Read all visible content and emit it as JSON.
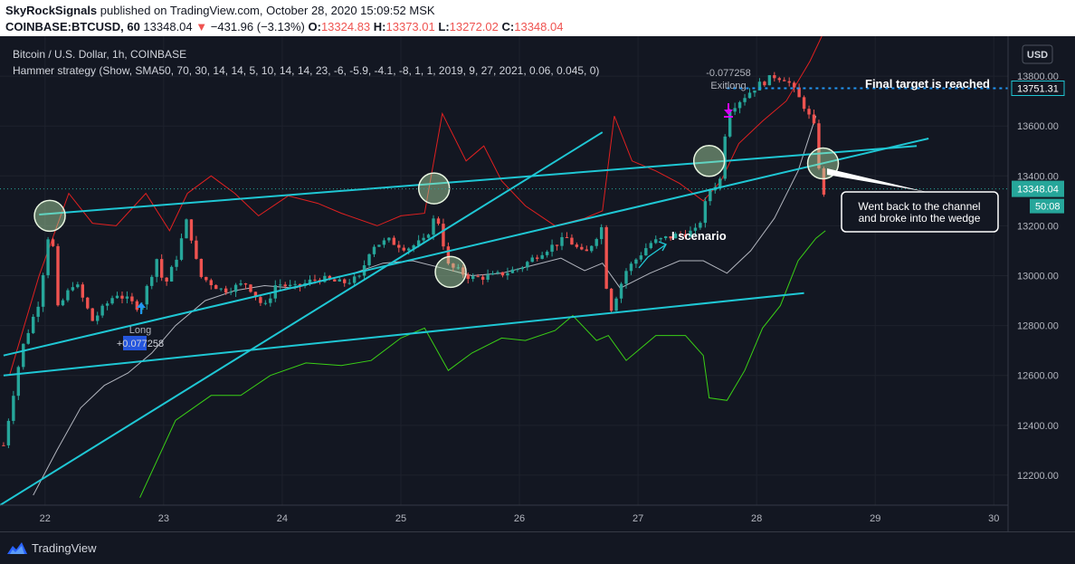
{
  "header": {
    "author": "SkyRockSignals",
    "published_text": "published on TradingView.com, October 28, 2020 15:09:52 MSK",
    "symbol": "COINBASE:BTCUSD, 60",
    "last": "13348.04",
    "change_arrow": "▼",
    "change": "−431.96 (−3.13%)",
    "o_label": "O:",
    "o": "13324.83",
    "h_label": "H:",
    "h": "13373.01",
    "l_label": "L:",
    "l": "13272.02",
    "c_label": "C:",
    "c": "13348.04"
  },
  "legend": {
    "title": "Bitcoin / U.S. Dollar, 1h, COINBASE",
    "study": "Hammer strategy (Show, SMA50, 70, 30, 14, 14, 5, 10, 14, 14, 23, -6, -5.9, -4.1, -8, 1, 1, 2019, 9, 27, 2021, 0.06, 0.045, 0)"
  },
  "currency_button": "USD",
  "price_tags": {
    "target": "13751.31",
    "last": "13348.04",
    "countdown": "50:08"
  },
  "annotations": {
    "final_target": "Final target is reached",
    "scenario": "I scenario",
    "callout_line1": "Went back to the channel",
    "callout_line2": "and broke into the wedge",
    "long_label": "Long",
    "long_value": "+0.077258",
    "exit_value": "-0.077258",
    "exit_label": "Exitlong"
  },
  "footer": {
    "brand": "TradingView"
  },
  "colors": {
    "background": "#131722",
    "up": "#26a69a",
    "down": "#ef5350",
    "trendline": "#1fc7d4",
    "upper_band": "#e02020",
    "lower_band": "#3ad016",
    "sma": "#b2b5be",
    "target_line": "#2196f3"
  },
  "chart_data": {
    "type": "candlestick",
    "title": "Bitcoin / U.S. Dollar, 1h, COINBASE",
    "x_ticks": [
      "22",
      "23",
      "24",
      "25",
      "26",
      "27",
      "28",
      "29",
      "30"
    ],
    "y_ticks": [
      "12200.00",
      "12400.00",
      "12600.00",
      "12800.00",
      "13000.00",
      "13200.00",
      "13400.00",
      "13600.00",
      "13800.00"
    ],
    "ylim": [
      12080,
      13960
    ],
    "xlim_days": [
      21.62,
      30.12
    ],
    "grid": true,
    "last_price": 13348.04,
    "target_price": 13751.31,
    "price_path": [
      [
        21.65,
        12320
      ],
      [
        21.8,
        12700
      ],
      [
        21.95,
        12900
      ],
      [
        22.05,
        13240
      ],
      [
        22.1,
        12860
      ],
      [
        22.25,
        12980
      ],
      [
        22.4,
        12820
      ],
      [
        22.6,
        12930
      ],
      [
        22.8,
        12870
      ],
      [
        22.95,
        13080
      ],
      [
        23.0,
        12950
      ],
      [
        23.1,
        13060
      ],
      [
        23.2,
        13230
      ],
      [
        23.3,
        13000
      ],
      [
        23.5,
        12940
      ],
      [
        23.7,
        12970
      ],
      [
        23.85,
        12870
      ],
      [
        23.95,
        12970
      ],
      [
        24.1,
        12950
      ],
      [
        24.3,
        12990
      ],
      [
        24.5,
        12970
      ],
      [
        24.65,
        12990
      ],
      [
        24.75,
        13120
      ],
      [
        24.9,
        13140
      ],
      [
        25.05,
        13110
      ],
      [
        25.2,
        13140
      ],
      [
        25.3,
        13250
      ],
      [
        25.4,
        13040
      ],
      [
        25.6,
        12990
      ],
      [
        25.8,
        13000
      ],
      [
        26.0,
        13030
      ],
      [
        26.2,
        13100
      ],
      [
        26.4,
        13150
      ],
      [
        26.55,
        13080
      ],
      [
        26.7,
        13200
      ],
      [
        26.75,
        12840
      ],
      [
        26.9,
        13020
      ],
      [
        27.1,
        13130
      ],
      [
        27.3,
        13160
      ],
      [
        27.5,
        13180
      ],
      [
        27.6,
        13340
      ],
      [
        27.7,
        13390
      ],
      [
        27.75,
        13660
      ],
      [
        27.85,
        13700
      ],
      [
        28.0,
        13760
      ],
      [
        28.15,
        13800
      ],
      [
        28.25,
        13790
      ],
      [
        28.4,
        13680
      ],
      [
        28.5,
        13580
      ],
      [
        28.55,
        13300
      ],
      [
        28.6,
        13348
      ]
    ],
    "upper_band": [
      [
        21.7,
        12600
      ],
      [
        21.95,
        13000
      ],
      [
        22.2,
        13330
      ],
      [
        22.4,
        13210
      ],
      [
        22.6,
        13200
      ],
      [
        22.85,
        13330
      ],
      [
        23.05,
        13180
      ],
      [
        23.2,
        13330
      ],
      [
        23.4,
        13400
      ],
      [
        23.6,
        13330
      ],
      [
        23.8,
        13240
      ],
      [
        24.05,
        13320
      ],
      [
        24.3,
        13290
      ],
      [
        24.5,
        13250
      ],
      [
        24.8,
        13200
      ],
      [
        25.0,
        13240
      ],
      [
        25.2,
        13250
      ],
      [
        25.35,
        13650
      ],
      [
        25.55,
        13460
      ],
      [
        25.7,
        13520
      ],
      [
        25.85,
        13380
      ],
      [
        26.05,
        13280
      ],
      [
        26.3,
        13200
      ],
      [
        26.55,
        13230
      ],
      [
        26.7,
        13260
      ],
      [
        26.8,
        13640
      ],
      [
        26.95,
        13460
      ],
      [
        27.15,
        13420
      ],
      [
        27.35,
        13370
      ],
      [
        27.55,
        13300
      ],
      [
        27.7,
        13380
      ],
      [
        27.85,
        13530
      ],
      [
        28.05,
        13620
      ],
      [
        28.25,
        13700
      ],
      [
        28.45,
        13860
      ],
      [
        28.55,
        13960
      ]
    ],
    "lower_band": [
      [
        22.8,
        12110
      ],
      [
        23.1,
        12420
      ],
      [
        23.4,
        12520
      ],
      [
        23.65,
        12520
      ],
      [
        23.9,
        12600
      ],
      [
        24.2,
        12650
      ],
      [
        24.5,
        12640
      ],
      [
        24.75,
        12660
      ],
      [
        25.0,
        12750
      ],
      [
        25.2,
        12790
      ],
      [
        25.4,
        12620
      ],
      [
        25.6,
        12690
      ],
      [
        25.85,
        12750
      ],
      [
        26.05,
        12740
      ],
      [
        26.3,
        12780
      ],
      [
        26.45,
        12840
      ],
      [
        26.65,
        12740
      ],
      [
        26.75,
        12760
      ],
      [
        26.9,
        12660
      ],
      [
        27.15,
        12760
      ],
      [
        27.4,
        12760
      ],
      [
        27.55,
        12680
      ],
      [
        27.6,
        12510
      ],
      [
        27.75,
        12500
      ],
      [
        27.9,
        12620
      ],
      [
        28.05,
        12790
      ],
      [
        28.2,
        12880
      ],
      [
        28.35,
        13060
      ],
      [
        28.5,
        13150
      ],
      [
        28.58,
        13180
      ]
    ],
    "sma": [
      [
        21.9,
        12120
      ],
      [
        22.1,
        12300
      ],
      [
        22.3,
        12470
      ],
      [
        22.5,
        12560
      ],
      [
        22.7,
        12610
      ],
      [
        22.9,
        12690
      ],
      [
        23.1,
        12800
      ],
      [
        23.35,
        12900
      ],
      [
        23.6,
        12940
      ],
      [
        23.85,
        12960
      ],
      [
        24.1,
        12950
      ],
      [
        24.35,
        12980
      ],
      [
        24.6,
        13010
      ],
      [
        24.85,
        13050
      ],
      [
        25.1,
        13060
      ],
      [
        25.35,
        13030
      ],
      [
        25.6,
        13000
      ],
      [
        25.85,
        13010
      ],
      [
        26.1,
        13040
      ],
      [
        26.35,
        13070
      ],
      [
        26.55,
        13020
      ],
      [
        26.7,
        13050
      ],
      [
        26.85,
        12950
      ],
      [
        27.1,
        13010
      ],
      [
        27.35,
        13060
      ],
      [
        27.55,
        13060
      ],
      [
        27.75,
        13010
      ],
      [
        27.95,
        13100
      ],
      [
        28.15,
        13230
      ],
      [
        28.35,
        13420
      ],
      [
        28.5,
        13640
      ]
    ],
    "trendlines": [
      {
        "from": [
          21.65,
          12680
        ],
        "to": [
          29.45,
          13550
        ]
      },
      {
        "from": [
          21.65,
          12600
        ],
        "to": [
          28.4,
          12930
        ]
      },
      {
        "from": [
          21.95,
          13245
        ],
        "to": [
          29.35,
          13520
        ]
      },
      {
        "from": [
          21.62,
          12080
        ],
        "to": [
          26.7,
          13575
        ]
      }
    ],
    "highlight_circles": [
      {
        "day": 22.04,
        "price": 13240
      },
      {
        "day": 25.28,
        "price": 13350
      },
      {
        "day": 25.42,
        "price": 13015
      },
      {
        "day": 27.6,
        "price": 13460
      },
      {
        "day": 28.56,
        "price": 13450
      }
    ]
  }
}
